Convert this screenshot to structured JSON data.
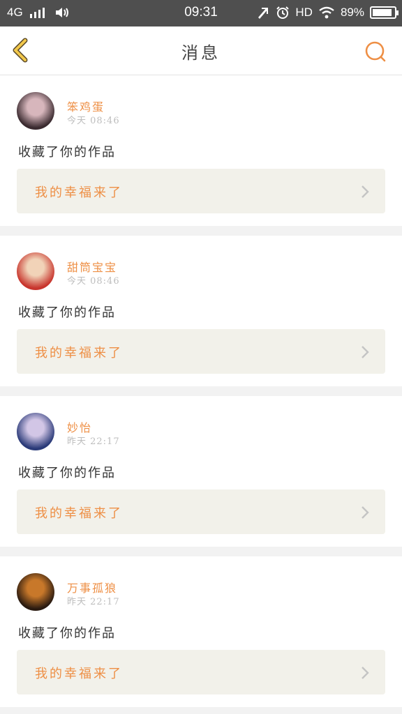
{
  "status_bar": {
    "network": "4G",
    "time": "09:31",
    "hd": "HD",
    "battery": "89%",
    "battery_level": 0.89
  },
  "header": {
    "title": "消息"
  },
  "messages": [
    {
      "username": "笨鸡蛋",
      "time": "今天 08:46",
      "action": "收藏了你的作品",
      "work_title": "我的幸福来了",
      "avatar_colors": [
        "#3a2a2f",
        "#d7b6bc"
      ]
    },
    {
      "username": "甜筒宝宝",
      "time": "今天 08:46",
      "action": "收藏了你的作品",
      "work_title": "我的幸福来了",
      "avatar_colors": [
        "#c8352d",
        "#f1d3b8"
      ]
    },
    {
      "username": "妙怡",
      "time": "昨天 22:17",
      "action": "收藏了你的作品",
      "work_title": "我的幸福来了",
      "avatar_colors": [
        "#2a3a78",
        "#d2c6e6"
      ]
    },
    {
      "username": "万事孤狼",
      "time": "昨天 22:17",
      "action": "收藏了你的作品",
      "work_title": "我的幸福来了",
      "avatar_colors": [
        "#2a1a10",
        "#c8782a"
      ]
    }
  ],
  "colors": {
    "accent": "#ee8f45",
    "back_arrow": "#f2c84b"
  }
}
